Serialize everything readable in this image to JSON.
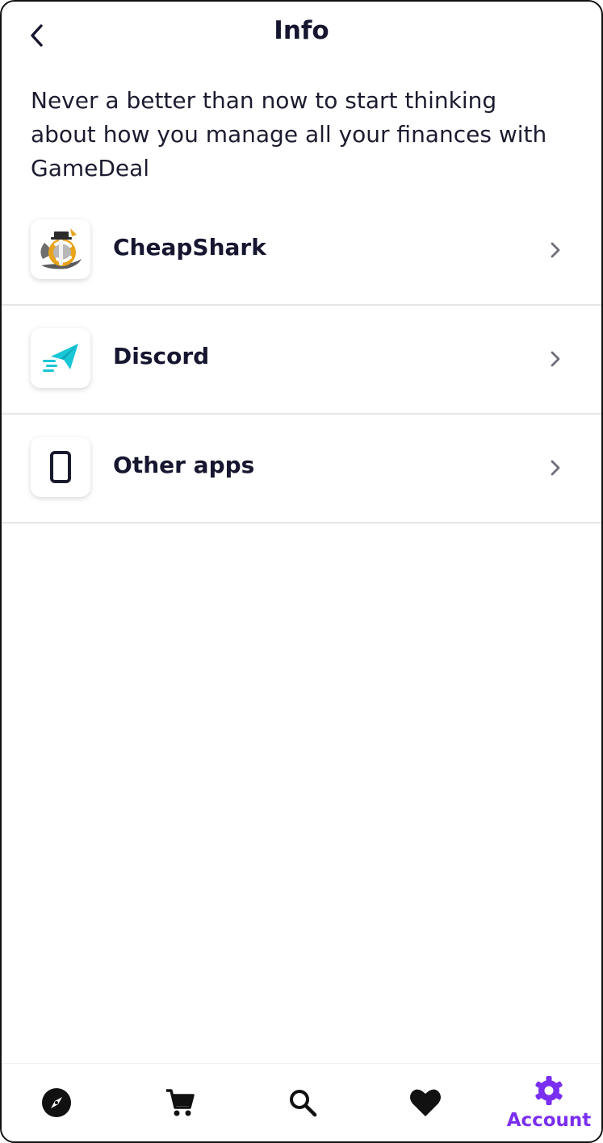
{
  "header": {
    "title": "Info",
    "back_icon": "chevron-left-icon"
  },
  "intro": {
    "text": "Never a better than now to start thinking about how you manage all your finances with GameDeal"
  },
  "apps": [
    {
      "label": "CheapShark",
      "icon": "cheapshark-logo-icon"
    },
    {
      "label": "Discord",
      "icon": "paper-plane-icon"
    },
    {
      "label": "Other apps",
      "icon": "smartphone-icon"
    }
  ],
  "bottom_nav": {
    "items": [
      {
        "icon": "compass-icon",
        "label": ""
      },
      {
        "icon": "cart-icon",
        "label": ""
      },
      {
        "icon": "search-icon",
        "label": ""
      },
      {
        "icon": "heart-icon",
        "label": ""
      },
      {
        "icon": "gear-icon",
        "label": "Account",
        "active": true
      }
    ]
  },
  "colors": {
    "accent": "#7a2ff0",
    "text": "#161630",
    "divider": "#e6e6ea",
    "discord_icon": "#19c6d6"
  }
}
